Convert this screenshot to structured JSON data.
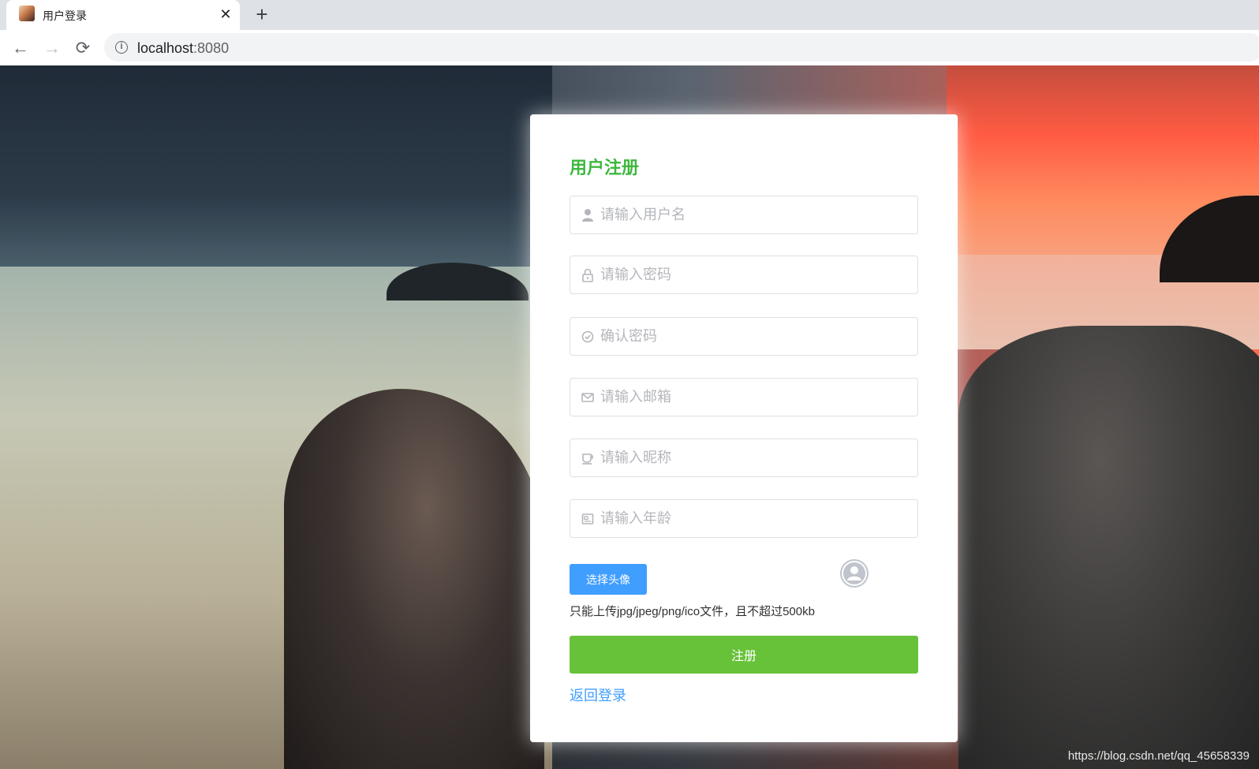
{
  "browser": {
    "tab_title": "用户登录",
    "tab_close": "✕",
    "new_tab": "+",
    "back": "←",
    "forward": "→",
    "reload": "⟳",
    "url_host": "localhost",
    "url_port": ":8080",
    "info_glyph": "i"
  },
  "form": {
    "title": "用户注册",
    "fields": [
      {
        "icon": "user-icon",
        "placeholder": "请输入用户名",
        "type": "text"
      },
      {
        "icon": "lock-icon",
        "placeholder": "请输入密码",
        "type": "password"
      },
      {
        "icon": "circle-check-icon",
        "placeholder": "确认密码",
        "type": "password"
      },
      {
        "icon": "message-icon",
        "placeholder": "请输入邮箱",
        "type": "text"
      },
      {
        "icon": "coffee-cup-icon",
        "placeholder": "请输入昵称",
        "type": "text"
      },
      {
        "icon": "postcard-icon",
        "placeholder": "请输入年龄",
        "type": "text"
      }
    ],
    "upload_label": "选择头像",
    "upload_hint": "只能上传jpg/jpeg/png/ico文件，且不超过500kb",
    "submit_label": "注册",
    "back_link": "返回登录"
  },
  "watermark": "https://blog.csdn.net/qq_45658339",
  "colors": {
    "title": "#3fb83f",
    "primary": "#409eff",
    "success": "#67c23a",
    "placeholder": "#b4b6bb",
    "border": "#dcdfe6"
  }
}
